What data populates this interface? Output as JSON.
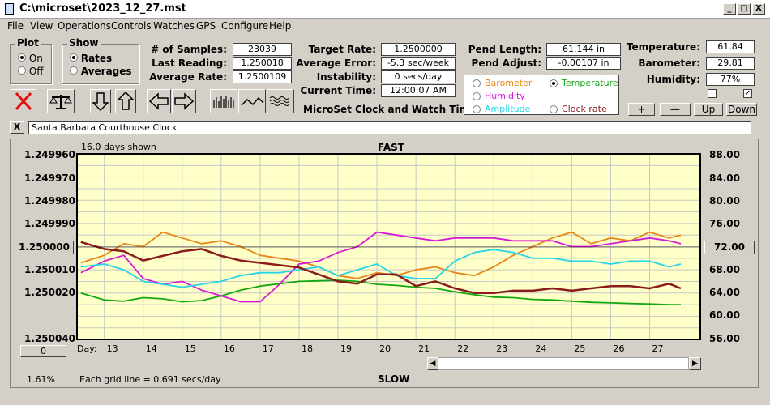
{
  "window": {
    "title": "C:\\microset\\2023_12_27.mst",
    "minimize": "_",
    "maximize": "□",
    "close": "X"
  },
  "menu": [
    "File",
    "View",
    "Operations",
    "Controls",
    "Watches",
    "GPS",
    "Configure",
    "Help"
  ],
  "plot_group": {
    "legend": "Plot",
    "on": "On",
    "off": "Off",
    "selected": "On"
  },
  "show_group": {
    "legend": "Show",
    "rates": "Rates",
    "averages": "Averages",
    "selected": "Rates"
  },
  "stats": {
    "samples_label": "# of Samples:",
    "samples": "23039",
    "last_reading_label": "Last Reading:",
    "last_reading": "1.250018",
    "average_rate_label": "Average Rate:",
    "average_rate": "1.2500109",
    "target_rate_label": "Target Rate:",
    "target_rate": "1.2500000",
    "average_error_label": "Average Error:",
    "average_error": "-5.3 sec/week",
    "instability_label": "Instability:",
    "instability": "0 secs/day",
    "current_time_label": "Current Time:",
    "current_time": "12:00:07 AM",
    "pend_length_label": "Pend Length:",
    "pend_length": "61.144 in",
    "pend_adjust_label": "Pend Adjust:",
    "pend_adjust": "-0.00107 in",
    "temperature_label": "Temperature:",
    "temperature": "61.84",
    "barometer_label": "Barometer:",
    "barometer": "29.81",
    "humidity_label": "Humidity:",
    "humidity": "77%"
  },
  "app_title": "MicroSet Clock and Watch Timer",
  "toolbar_icons": [
    "clear-icon",
    "balance-scale-icon",
    "arrow-down-icon",
    "arrow-up-icon",
    "arrow-left-icon",
    "arrow-right-icon",
    "bar-graph-icon",
    "line-graph-icon",
    "wave-graph-icon"
  ],
  "legend": {
    "items": [
      {
        "label": "Barometer",
        "color": "#e8861a",
        "selected": false
      },
      {
        "label": "Temperature",
        "color": "#13a813",
        "selected": true
      },
      {
        "label": "Humidity",
        "color": "#d71ad7",
        "selected": false
      },
      {
        "label": "Amplitude",
        "color": "#26d6e6",
        "selected": false
      },
      {
        "label": "Clock rate",
        "color": "#8b1c1c",
        "selected": false
      }
    ]
  },
  "scale_buttons": {
    "plus": "+",
    "minus": "—",
    "up": "Up",
    "down": "Down"
  },
  "checkbox_checked": "✓",
  "close_x": "X",
  "clock_name": "Santa Barbara Courthouse Clock",
  "chart_top": {
    "days_shown": "16.0 days shown",
    "fast": "FAST"
  },
  "chart_bottom": {
    "slow": "SLOW",
    "grid_note": "Each grid line = 0.691 secs/day",
    "percent": "1.61%",
    "zero_button": "0",
    "day_label": "Day:"
  },
  "left_center_button": "1.250000",
  "right_center_button": "72.00",
  "chart_data": {
    "type": "line",
    "x_label": "Day:",
    "x_ticks": [
      "13",
      "14",
      "15",
      "16",
      "17",
      "18",
      "19",
      "20",
      "21",
      "22",
      "23",
      "24",
      "25",
      "26",
      "27"
    ],
    "x_range": [
      12.3,
      28.3
    ],
    "y_left_ticks": [
      "1.249960",
      "1.249970",
      "1.249980",
      "1.249990",
      "1.250010",
      "1.250020",
      "1.250040"
    ],
    "y_left_range": [
      1.24996,
      1.25004
    ],
    "y_right_ticks": [
      "88.00",
      "84.00",
      "80.00",
      "76.00",
      "68.00",
      "64.00",
      "60.00",
      "56.00"
    ],
    "y_right_range": [
      56,
      88
    ],
    "grid": true,
    "series": [
      {
        "name": "Barometer",
        "color": "#e8861a",
        "x": [
          12.4,
          13,
          13.5,
          14,
          14.5,
          15,
          15.5,
          16,
          16.5,
          17,
          17.5,
          18,
          18.5,
          19,
          19.5,
          20,
          20.5,
          21,
          21.5,
          22,
          22.5,
          23,
          23.5,
          24,
          24.5,
          25,
          25.5,
          26,
          26.5,
          27,
          27.5,
          27.8
        ],
        "y": [
          69.2,
          70.5,
          72.5,
          72.0,
          74.5,
          73.5,
          72.5,
          73.0,
          72.0,
          70.5,
          70.0,
          69.5,
          68.5,
          67.0,
          66.5,
          67.5,
          67.0,
          68.0,
          68.5,
          67.5,
          67.0,
          68.5,
          70.5,
          72.0,
          73.5,
          74.5,
          72.5,
          73.5,
          73.0,
          74.5,
          73.5,
          74.0
        ]
      },
      {
        "name": "Temperature",
        "color": "#13a813",
        "x": [
          12.4,
          13,
          13.5,
          14,
          14.5,
          15,
          15.5,
          16,
          16.5,
          17,
          17.5,
          18,
          18.5,
          19,
          19.5,
          20,
          20.5,
          21,
          21.5,
          22,
          22.5,
          23,
          23.5,
          24,
          24.5,
          25,
          25.5,
          26,
          26.5,
          27,
          27.5,
          27.8
        ],
        "y": [
          64.0,
          62.8,
          62.6,
          63.2,
          63.0,
          62.5,
          62.7,
          63.5,
          64.5,
          65.2,
          65.6,
          66.0,
          66.1,
          66.2,
          66.0,
          65.5,
          65.3,
          65.0,
          64.8,
          64.2,
          63.7,
          63.3,
          63.2,
          62.9,
          62.8,
          62.6,
          62.4,
          62.3,
          62.2,
          62.1,
          62.0,
          62.0
        ]
      },
      {
        "name": "Humidity",
        "color": "#d71ad7",
        "x": [
          12.4,
          13,
          13.5,
          14,
          14.5,
          15,
          15.5,
          16,
          16.5,
          17,
          17.5,
          18,
          18.5,
          19,
          19.5,
          20,
          20.5,
          21,
          21.5,
          22,
          22.5,
          23,
          23.5,
          24,
          24.5,
          25,
          25.5,
          26,
          26.5,
          27,
          27.5,
          27.8
        ],
        "y": [
          67.5,
          69.5,
          70.5,
          66.5,
          65.5,
          66.0,
          64.5,
          63.5,
          62.5,
          62.5,
          65.5,
          69.0,
          69.5,
          71.0,
          72.0,
          74.5,
          74.0,
          73.5,
          73.0,
          73.5,
          73.5,
          73.5,
          73.0,
          73.0,
          73.0,
          72.0,
          72.0,
          72.5,
          73.0,
          73.5,
          73.0,
          72.5
        ]
      },
      {
        "name": "Amplitude",
        "color": "#26d6e6",
        "x": [
          12.4,
          13,
          13.5,
          14,
          14.5,
          15,
          15.5,
          16,
          16.5,
          17,
          17.5,
          18,
          18.5,
          19,
          19.5,
          20,
          20.5,
          21,
          21.5,
          22,
          22.5,
          23,
          23.5,
          24,
          24.5,
          25,
          25.5,
          26,
          26.5,
          27,
          27.5,
          27.8
        ],
        "y": [
          68.5,
          69.0,
          68.0,
          66.0,
          65.5,
          65.0,
          65.5,
          66.0,
          67.0,
          67.5,
          67.5,
          68.0,
          68.5,
          67.0,
          68.0,
          69.0,
          67.0,
          66.5,
          66.5,
          69.5,
          71.0,
          71.5,
          71.0,
          70.0,
          70.0,
          69.5,
          69.5,
          69.0,
          69.5,
          69.5,
          68.5,
          69.0
        ]
      },
      {
        "name": "Clock rate",
        "color": "#8b1c1c",
        "x": [
          12.4,
          13,
          13.5,
          14,
          14.5,
          15,
          15.5,
          16,
          16.5,
          17,
          17.5,
          18,
          18.5,
          19,
          19.5,
          20,
          20.5,
          21,
          21.5,
          22,
          22.5,
          23,
          23.5,
          24,
          24.5,
          25,
          25.5,
          26,
          26.5,
          27,
          27.5,
          27.8
        ],
        "y": [
          1.249998,
          1.250001,
          1.250002,
          1.250006,
          1.250004,
          1.250002,
          1.250001,
          1.250004,
          1.250006,
          1.250007,
          1.250008,
          1.250009,
          1.250012,
          1.250015,
          1.250016,
          1.250012,
          1.250012,
          1.250017,
          1.250015,
          1.250018,
          1.25002,
          1.25002,
          1.250019,
          1.250019,
          1.250018,
          1.250019,
          1.250018,
          1.250017,
          1.250017,
          1.250018,
          1.250016,
          1.250018
        ]
      }
    ]
  }
}
